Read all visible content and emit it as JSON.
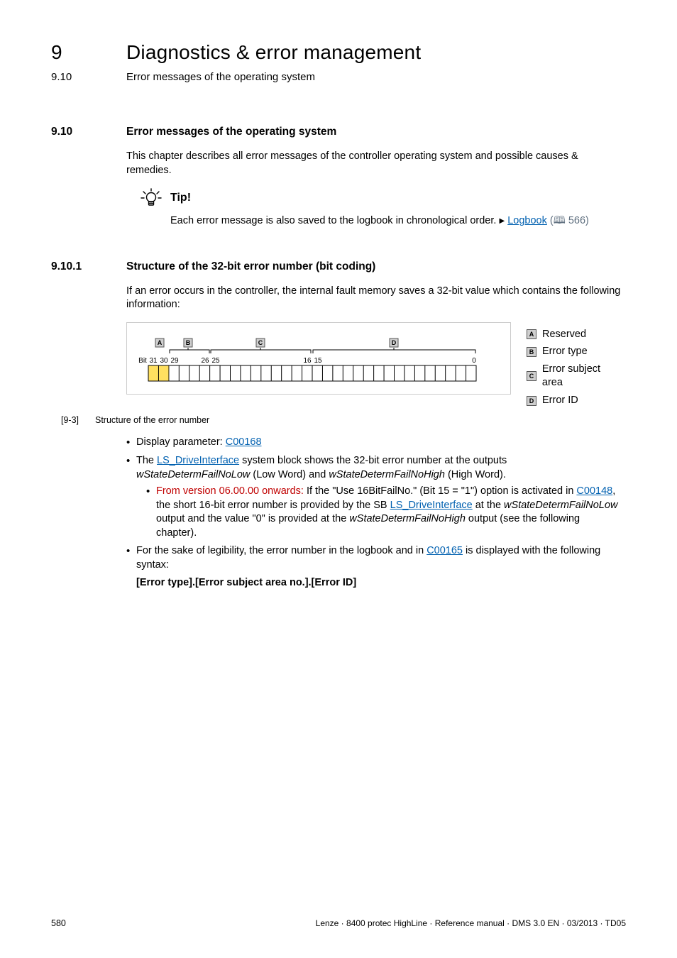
{
  "header": {
    "chapter_num": "9",
    "chapter_title": "Diagnostics & error management",
    "section_num": "9.10",
    "section_title": "Error messages of the operating system"
  },
  "sec910": {
    "num": "9.10",
    "title": "Error messages of the operating system",
    "para1": "This chapter describes all error messages of the controller operating system and possible causes & remedies.",
    "tip_label": "Tip!",
    "tip_body_a": "Each error message is also saved to the logbook in chronological order.  ",
    "tip_link": "Logbook",
    "tip_pref": "(🕮 566)"
  },
  "sec9101": {
    "num": "9.10.1",
    "title": "Structure of the 32-bit error number (bit coding)",
    "para1": "If an error occurs in the controller, the internal fault memory saves a 32-bit value which contains the following information:",
    "key": {
      "A": "Reserved",
      "B": "Error type",
      "C": "Error subject area",
      "D": "Error ID"
    },
    "fig": {
      "bitlbl": "Bit",
      "ticks": {
        "31": "31",
        "30": "30",
        "29": "29",
        "26": "26",
        "25": "25",
        "16": "16",
        "15": "15",
        "0": "0"
      }
    },
    "figcap_num": "[9-3]",
    "figcap_txt": "Structure of the error number",
    "li1_a": "Display parameter: ",
    "li1_link": "C00168",
    "li2_a": "The ",
    "li2_link1": "LS_DriveInterface",
    "li2_b": " system block shows the 32-bit error number at the outputs ",
    "li2_i1": "wStateDetermFailNoLow",
    "li2_c": " (Low Word) and ",
    "li2_i2": "wStateDetermFailNoHigh",
    "li2_d": " (High Word).",
    "li2s_red": "From version 06.00.00 onwards:",
    "li2s_a": " If the \"Use 16BitFailNo.\" (Bit 15 = \"1\") option is activated in ",
    "li2s_link1": "C00148",
    "li2s_b": ", the short 16-bit error number is provided by the SB ",
    "li2s_link2": "LS_DriveInterface",
    "li2s_c": " at the ",
    "li2s_i1": "wStateDetermFailNoLow",
    "li2s_d": " output and the value \"0\" is provided at the ",
    "li2s_i2": "wStateDetermFailNoHigh",
    "li2s_e": " output (see the following chapter).",
    "li3_a": "For the sake of legibility, the error number in the logbook and in ",
    "li3_link": "C00165",
    "li3_b": " is displayed with the following syntax:",
    "li3c": "[Error type].[Error subject area no.].[Error ID]"
  },
  "footer": {
    "page": "580",
    "meta": "Lenze · 8400 protec HighLine · Reference manual · DMS 3.0 EN · 03/2013 · TD05"
  }
}
